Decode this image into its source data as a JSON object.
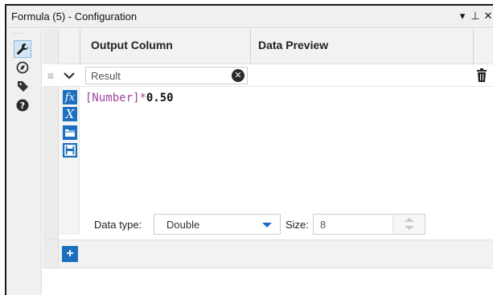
{
  "window": {
    "title": "Formula (5) - Configuration",
    "controls": {
      "menu": "▾",
      "pin": "⊥",
      "close": "✕"
    }
  },
  "sidebar": {
    "overflow": "···",
    "items": [
      {
        "icon": "wrench-icon",
        "active": true
      },
      {
        "icon": "navigate-icon",
        "active": false
      },
      {
        "icon": "tag-icon",
        "active": false
      },
      {
        "icon": "help-icon",
        "active": false
      }
    ]
  },
  "table": {
    "columns": {
      "output": "Output Column",
      "preview": "Data Preview"
    },
    "row": {
      "output_value": "Result",
      "clear": "✕"
    }
  },
  "expression": {
    "field": "[Number]",
    "operator": "*",
    "number": "0.50"
  },
  "tools": {
    "fx": "fx",
    "x": "X"
  },
  "datatype": {
    "label": "Data type:",
    "value": "Double",
    "size_label": "Size:",
    "size_value": "8"
  },
  "add_row": {
    "label": "+"
  },
  "colors": {
    "accent": "#1c6fbf",
    "field": "#a0449e"
  }
}
